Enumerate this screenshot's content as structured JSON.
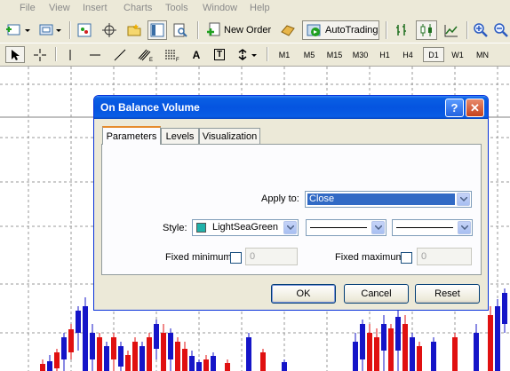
{
  "menu": {
    "items": [
      "File",
      "View",
      "Insert",
      "Charts",
      "Tools",
      "Window",
      "Help"
    ]
  },
  "toolbar": {
    "new_order_label": "New Order",
    "autotrading_label": "AutoTrading",
    "drawing_text_a": "A",
    "drawing_text_t": "T",
    "timeframes": [
      "M1",
      "M5",
      "M15",
      "M30",
      "H1",
      "H4",
      "D1",
      "W1",
      "MN"
    ],
    "active_timeframe": "D1"
  },
  "dialog": {
    "title": "On Balance Volume",
    "help_glyph": "?",
    "close_glyph": "✕",
    "tabs": [
      "Parameters",
      "Levels",
      "Visualization"
    ],
    "active_tab": "Parameters",
    "apply_to_label": "Apply to:",
    "apply_to_value": "Close",
    "style_label": "Style:",
    "style_color_name": "LightSeaGreen",
    "style_color_hex": "#20b2aa",
    "fixed_min_label": "Fixed minimum",
    "fixed_min_value": "0",
    "fixed_max_label": "Fixed maximum",
    "fixed_max_value": "0",
    "ok_label": "OK",
    "cancel_label": "Cancel",
    "reset_label": "Reset"
  },
  "colors": {
    "bull_candle": "#1515c8",
    "bear_candle": "#e01010",
    "xp_blue": "#0554e0"
  }
}
